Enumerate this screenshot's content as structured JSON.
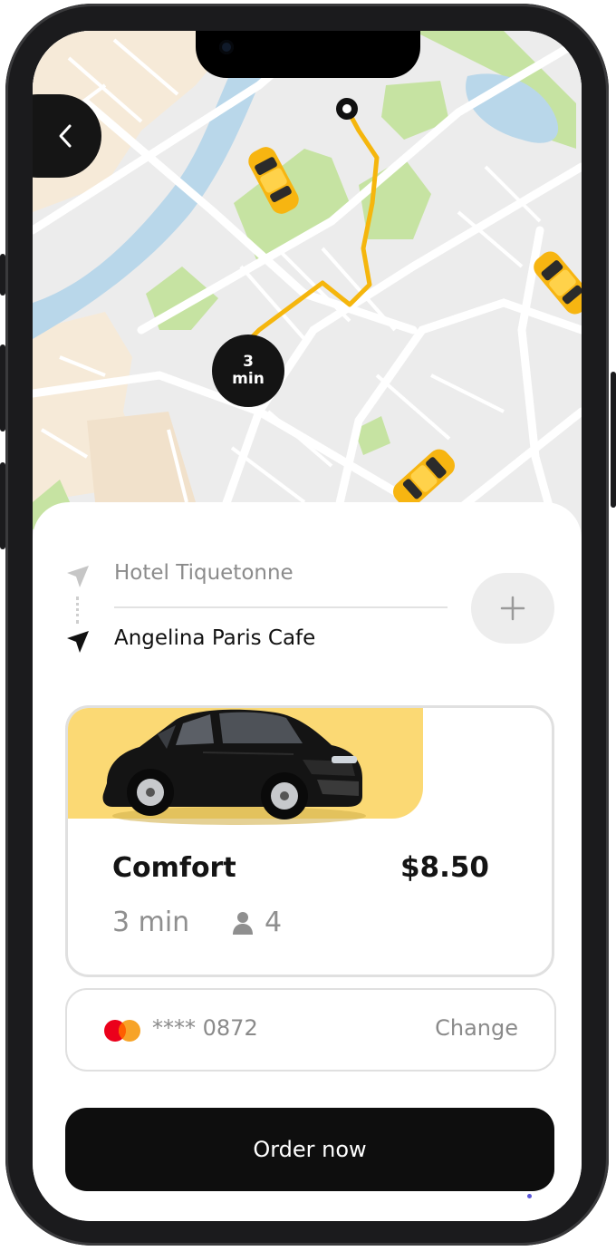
{
  "map": {
    "eta_value": "3",
    "eta_unit": "min"
  },
  "route": {
    "from": "Hotel Tiquetonne",
    "to": "Angelina Paris Cafe"
  },
  "ride": {
    "name": "Comfort",
    "price": "$8.50",
    "time": "3 min",
    "seats": "4"
  },
  "payment": {
    "card": "**** 0872",
    "change_label": "Change"
  },
  "order_label": "Order now",
  "colors": {
    "accent_yellow": "#fbd974",
    "route_yellow": "#f5b60d",
    "dark": "#0e0e0e"
  },
  "icons": [
    "back-chevron-icon",
    "pickup-arrow-icon",
    "destination-arrow-icon",
    "plus-icon",
    "person-icon",
    "mastercard-icon",
    "taxi-car-icon"
  ]
}
